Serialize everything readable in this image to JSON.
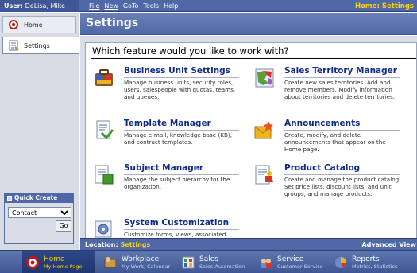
{
  "topbar": {
    "user_label": "User:",
    "user_name": "DeLisa, Mike",
    "menu": [
      "File",
      "New",
      "GoTo",
      "Tools",
      "Help"
    ],
    "breadcrumb": "Home: Settings"
  },
  "leftnav": {
    "items": [
      {
        "label": "Home",
        "icon": "home-target-icon",
        "selected": false
      },
      {
        "label": "Settings",
        "icon": "settings-icon",
        "selected": true
      }
    ]
  },
  "quick_create": {
    "title": "Quick Create",
    "selected": "Contact",
    "go_label": "Go"
  },
  "main": {
    "header": "Settings",
    "question": "Which feature would you like to work with?",
    "features": [
      {
        "title": "Business Unit Settings",
        "description": "Manage business units, security roles, users, salespeople with quotas, teams, and queues.",
        "icon": "business-unit-icon"
      },
      {
        "title": "Sales Territory Manager",
        "description": "Create new sales territories. Add and remove members. Modify information about territories and delete territories.",
        "icon": "territory-icon"
      },
      {
        "title": "Template Manager",
        "description": "Manage e-mail, knowledge base (KB), and contract templates.",
        "icon": "template-icon"
      },
      {
        "title": "Announcements",
        "description": "Create, modify, and delete announcements that appear on the Home page.",
        "icon": "announcement-icon"
      },
      {
        "title": "Subject Manager",
        "description": "Manage the subject hierarchy for the organization.",
        "icon": "subject-icon"
      },
      {
        "title": "Product Catalog",
        "description": "Create and manage the product catalog. Set price lists, discount lists, and unit groups, and manage products.",
        "icon": "product-catalog-icon"
      },
      {
        "title": "System Customization",
        "description": "Customize forms, views, associated",
        "icon": "customization-icon"
      }
    ]
  },
  "location": {
    "label": "Location:",
    "value": "Settings",
    "advanced_view": "Advanced View"
  },
  "bottomnav": {
    "items": [
      {
        "title": "Home",
        "subtitle": "My Home Page",
        "icon": "home-icon",
        "active": true
      },
      {
        "title": "Workplace",
        "subtitle": "My Work, Calendar",
        "icon": "workplace-icon",
        "active": false
      },
      {
        "title": "Sales",
        "subtitle": "Sales Automation",
        "icon": "sales-icon",
        "active": false
      },
      {
        "title": "Service",
        "subtitle": "Customer Service",
        "icon": "service-icon",
        "active": false
      },
      {
        "title": "Reports",
        "subtitle": "Metrics, Statistics",
        "icon": "reports-icon",
        "active": false
      }
    ]
  }
}
